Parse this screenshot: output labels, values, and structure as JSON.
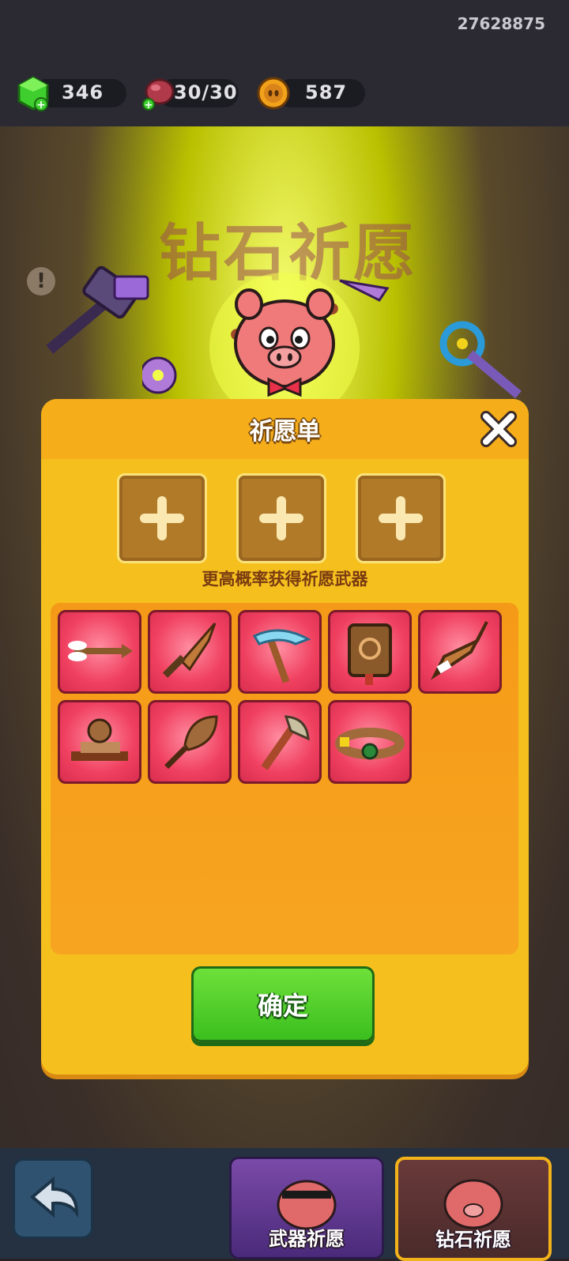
{
  "top_bar": {
    "user_id": "27628875",
    "gems": "346",
    "stamina": "30/30",
    "coins": "587"
  },
  "scene": {
    "banner_title": "钻石祈愿",
    "info_icon": "!"
  },
  "wish_modal": {
    "title": "祈愿单",
    "close_icon": "close-x-icon",
    "slots": [
      {
        "icon": "plus-icon"
      },
      {
        "icon": "plus-icon"
      },
      {
        "icon": "plus-icon"
      }
    ],
    "hint": "更高概率获得祈愿武器",
    "weapons": [
      {
        "name": "arrow"
      },
      {
        "name": "knife"
      },
      {
        "name": "ice-pickaxe"
      },
      {
        "name": "spell-book"
      },
      {
        "name": "boomerang"
      },
      {
        "name": "rock-on-board"
      },
      {
        "name": "leaf-fan"
      },
      {
        "name": "hatchet"
      },
      {
        "name": "belt"
      }
    ],
    "confirm_label": "确定"
  },
  "bottom_bar": {
    "back_icon": "back-arrow-icon",
    "tabs": [
      {
        "label": "武器祈愿"
      },
      {
        "label": "钻石祈愿"
      }
    ]
  },
  "colors": {
    "modal_bg": "#f5c01e",
    "header_bg": "#f5ad1a",
    "cell_bg": "#f04060",
    "confirm_green": "#3bbf1e"
  }
}
